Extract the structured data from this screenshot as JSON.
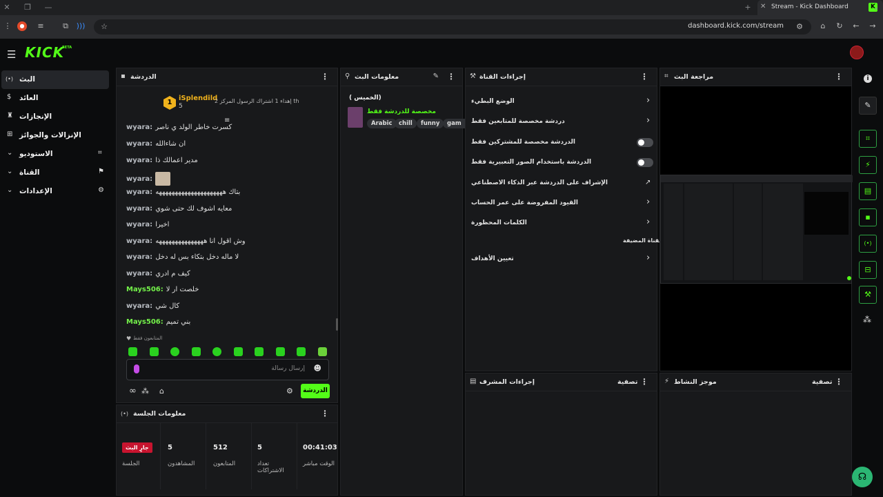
{
  "browser": {
    "tab_title": "Stream - Kick Dashboard",
    "tab_favicon": "K",
    "url": "dashboard.kick.com/stream"
  },
  "app": {
    "logo": "KICK",
    "beta": "BETA"
  },
  "sidebar": {
    "items": [
      {
        "label": "البث",
        "icon": "live-icon",
        "glyph": "(•)"
      },
      {
        "label": "العائد",
        "icon": "money-icon",
        "glyph": "$"
      },
      {
        "label": "الإنجازات",
        "icon": "trophy-icon",
        "glyph": "🏆"
      },
      {
        "label": "الإنزالات والجوائز",
        "icon": "drops-icon",
        "glyph": "⛬"
      },
      {
        "label": "الاستوديو",
        "icon": "studio-icon",
        "glyph": "⌗"
      },
      {
        "label": "القناة",
        "icon": "channel-icon",
        "glyph": "⚑"
      },
      {
        "label": "الإعدادات",
        "icon": "settings-icon",
        "glyph": "⚙"
      }
    ]
  },
  "chat": {
    "title": "الدردشة",
    "pinned_user": "iSplendild",
    "pinned_count": "5",
    "pinned_rank": "1",
    "pinned_text": "إهداء 1 اشتراك الرسول المركز 2 th",
    "messages": [
      {
        "user": "wyara:",
        "text": "كسرت خاطر الولد ي ناصر",
        "green": false
      },
      {
        "user": "wyara:",
        "text": "ان شاءالله",
        "green": false
      },
      {
        "user": "wyara:",
        "text": "مدير اعمالك ذا",
        "green": false
      },
      {
        "user": "wyara:",
        "text": "",
        "green": false,
        "emote": true
      },
      {
        "user": "wyara:",
        "text": "بتاك هههههههههههههههههههههه",
        "green": false
      },
      {
        "user": "wyara:",
        "text": "معايه اشوف لك حتى شوي",
        "green": false
      },
      {
        "user": "wyara:",
        "text": "اخيرا",
        "green": false
      },
      {
        "user": "wyara:",
        "text": "وش اقول انا هههههههههههههههه",
        "green": false
      },
      {
        "user": "wyara:",
        "text": "لا ماله دخل بتكاء بس له دخل",
        "green": false
      },
      {
        "user": "wyara:",
        "text": "كيف م ادري",
        "green": false
      },
      {
        "user": "Mays506:",
        "text": "خلصت ار لا",
        "green": true
      },
      {
        "user": "wyara:",
        "text": "كال شي",
        "green": false
      },
      {
        "user": "Mays506:",
        "text": "بني تميم",
        "green": true
      }
    ],
    "followers_only": "المتابعون فقط",
    "input_placeholder": "إرسال رسالة",
    "send_label": "الدردشة"
  },
  "session": {
    "title": "معلومات الجلسة",
    "live_badge": "جارٍ البث",
    "stats": [
      {
        "value": "00:41:03",
        "label": "الوقت مباشر"
      },
      {
        "value": "5",
        "label": "تعداد الاشتراكات"
      },
      {
        "value": "512",
        "label": "المتابعون"
      },
      {
        "value": "5",
        "label": "المشاهدون"
      },
      {
        "value": "",
        "label": "الجلسة"
      }
    ]
  },
  "stream_info": {
    "title": "معلومات البث",
    "stream_title": "( الخميس)",
    "category": "مخصصة للدردشة فقط",
    "tags": [
      "Arabic",
      "chill",
      "funny",
      "gam"
    ]
  },
  "channel_actions": {
    "title": "إجراءات القناة",
    "rows": [
      {
        "label": "الوضع البطيء",
        "control": "chevron"
      },
      {
        "label": "دردشة مخصصة للمتابعين فقط",
        "control": "chevron"
      },
      {
        "label": "الدردشة مخصصة للمشتركين فقط",
        "control": "toggle"
      },
      {
        "label": "الدردشة باستخدام الصور التعبيرية فقط",
        "control": "toggle"
      },
      {
        "label": "الإشراف على الدردشة عبر الذكاء الاصطناعي",
        "control": "link"
      },
      {
        "label": "القيود المفروضة على عمر الحساب",
        "control": "chevron"
      },
      {
        "label": "الكلمات المحظورة",
        "control": "chevron"
      },
      {
        "label": "القناة المضيفة",
        "control": "none"
      },
      {
        "label": "تعيين الأهداف",
        "control": "chevron"
      }
    ]
  },
  "preview": {
    "title": "مراجعة البث"
  },
  "mod_actions": {
    "title": "إجراءات المشرف",
    "filter": "تصفية"
  },
  "activity": {
    "title": "موجز النشاط",
    "filter": "تصفية"
  },
  "rail": {
    "icons": [
      "info-icon",
      "edit-icon",
      "screen-icon",
      "bolt-icon",
      "notes-icon",
      "chat-icon",
      "broadcast-icon",
      "layout-icon",
      "wrench-icon",
      "connect-icon"
    ]
  },
  "colors": {
    "accent": "#53fc18",
    "live": "#c8142f"
  }
}
